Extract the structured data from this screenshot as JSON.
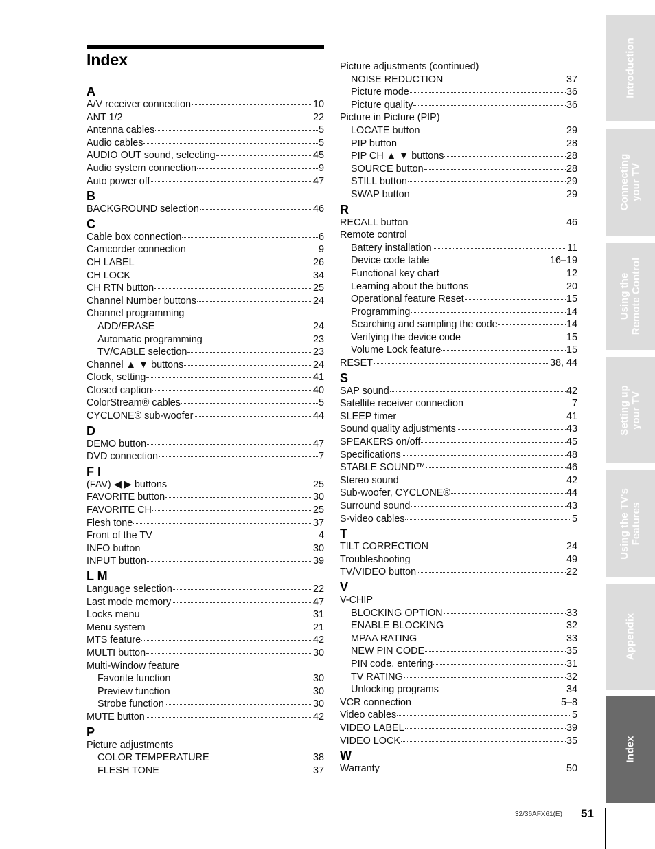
{
  "title": "Index",
  "left_column": [
    {
      "letter": "A",
      "entries": [
        {
          "label": "A/V receiver connection",
          "page": "10"
        },
        {
          "label": "ANT 1/2",
          "page": "22"
        },
        {
          "label": "Antenna cables",
          "page": "5"
        },
        {
          "label": "Audio cables",
          "page": "5"
        },
        {
          "label": "AUDIO OUT sound, selecting",
          "page": "45"
        },
        {
          "label": "Audio system connection",
          "page": "9"
        },
        {
          "label": "Auto power off",
          "page": "47"
        }
      ]
    },
    {
      "letter": "B",
      "entries": [
        {
          "label": "BACKGROUND selection",
          "page": "46"
        }
      ]
    },
    {
      "letter": "C",
      "entries": [
        {
          "label": "Cable box connection",
          "page": "6"
        },
        {
          "label": "Camcorder connection",
          "page": "9"
        },
        {
          "label": "CH LABEL",
          "page": "26"
        },
        {
          "label": "CH LOCK",
          "page": "34"
        },
        {
          "label": "CH RTN button",
          "page": "25"
        },
        {
          "label": "Channel Number buttons",
          "page": "24"
        },
        {
          "label": "Channel programming",
          "page": "",
          "head": true
        },
        {
          "label": "ADD/ERASE",
          "page": "24",
          "sub": true
        },
        {
          "label": "Automatic programming",
          "page": "23",
          "sub": true
        },
        {
          "label": "TV/CABLE selection",
          "page": "23",
          "sub": true
        },
        {
          "label": "Channel ▲ ▼ buttons",
          "page": "24"
        },
        {
          "label": "Clock, setting",
          "page": "41"
        },
        {
          "label": "Closed caption",
          "page": "40"
        },
        {
          "label": "ColorStream® cables",
          "page": "5"
        },
        {
          "label": "CYCLONE® sub-woofer",
          "page": "44"
        }
      ]
    },
    {
      "letter": "D",
      "entries": [
        {
          "label": "DEMO button",
          "page": "47"
        },
        {
          "label": "DVD connection",
          "page": "7"
        }
      ]
    },
    {
      "letter": "F I",
      "entries": [
        {
          "label": "(FAV) ◀ ▶ buttons",
          "page": "25"
        },
        {
          "label": "FAVORITE button",
          "page": "30"
        },
        {
          "label": "FAVORITE CH",
          "page": "25"
        },
        {
          "label": "Flesh tone",
          "page": "37"
        },
        {
          "label": "Front of the TV",
          "page": "4"
        },
        {
          "label": "INFO button",
          "page": "30"
        },
        {
          "label": "INPUT button",
          "page": "39"
        }
      ]
    },
    {
      "letter": "L M",
      "entries": [
        {
          "label": "Language selection",
          "page": "22"
        },
        {
          "label": "Last mode memory",
          "page": "47"
        },
        {
          "label": "Locks menu",
          "page": "31"
        },
        {
          "label": "Menu system",
          "page": "21"
        },
        {
          "label": "MTS feature",
          "page": "42"
        },
        {
          "label": "MULTI button",
          "page": "30"
        },
        {
          "label": "Multi-Window feature",
          "page": "",
          "head": true
        },
        {
          "label": "Favorite function",
          "page": "30",
          "sub": true
        },
        {
          "label": "Preview function",
          "page": "30",
          "sub": true
        },
        {
          "label": "Strobe function",
          "page": "30",
          "sub": true
        },
        {
          "label": "MUTE button",
          "page": "42"
        }
      ]
    },
    {
      "letter": "P",
      "entries": [
        {
          "label": "Picture adjustments",
          "page": "",
          "head": true
        },
        {
          "label": "COLOR TEMPERATURE",
          "page": "38",
          "sub": true
        },
        {
          "label": "FLESH TONE",
          "page": "37",
          "sub": true
        }
      ]
    }
  ],
  "right_column": [
    {
      "letter": "",
      "entries": [
        {
          "label": "Picture adjustments (continued)",
          "page": "",
          "head": true
        },
        {
          "label": "NOISE REDUCTION",
          "page": "37",
          "sub": true
        },
        {
          "label": "Picture mode",
          "page": "36",
          "sub": true
        },
        {
          "label": "Picture quality",
          "page": "36",
          "sub": true
        },
        {
          "label": "Picture in Picture (PIP)",
          "page": "",
          "head": true
        },
        {
          "label": "LOCATE button",
          "page": "29",
          "sub": true
        },
        {
          "label": "PIP button",
          "page": "28",
          "sub": true
        },
        {
          "label": "PIP CH ▲ ▼ buttons",
          "page": "28",
          "sub": true
        },
        {
          "label": "SOURCE button",
          "page": "28",
          "sub": true
        },
        {
          "label": "STILL button",
          "page": "29",
          "sub": true
        },
        {
          "label": "SWAP button",
          "page": "29",
          "sub": true
        }
      ]
    },
    {
      "letter": "R",
      "entries": [
        {
          "label": "RECALL button",
          "page": "46"
        },
        {
          "label": "Remote control",
          "page": "",
          "head": true
        },
        {
          "label": "Battery installation",
          "page": "11",
          "sub": true
        },
        {
          "label": "Device code table",
          "page": "16–19",
          "sub": true
        },
        {
          "label": "Functional key chart",
          "page": "12",
          "sub": true
        },
        {
          "label": "Learning about the buttons",
          "page": "20",
          "sub": true
        },
        {
          "label": "Operational feature Reset",
          "page": "15",
          "sub": true
        },
        {
          "label": "Programming",
          "page": "14",
          "sub": true
        },
        {
          "label": "Searching and sampling the code",
          "page": "14",
          "sub": true
        },
        {
          "label": "Verifying the device code",
          "page": "15",
          "sub": true
        },
        {
          "label": "Volume Lock feature",
          "page": "15",
          "sub": true
        },
        {
          "label": "RESET",
          "page": "38, 44"
        }
      ]
    },
    {
      "letter": "S",
      "entries": [
        {
          "label": "SAP sound",
          "page": "42"
        },
        {
          "label": "Satellite receiver connection",
          "page": "7"
        },
        {
          "label": "SLEEP timer",
          "page": "41"
        },
        {
          "label": "Sound quality adjustments",
          "page": "43"
        },
        {
          "label": "SPEAKERS on/off",
          "page": "45"
        },
        {
          "label": "Specifications",
          "page": "48"
        },
        {
          "label": "STABLE SOUND™",
          "page": "46"
        },
        {
          "label": "Stereo sound",
          "page": "42"
        },
        {
          "label": "Sub-woofer, CYCLONE®",
          "page": "44"
        },
        {
          "label": "Surround sound",
          "page": "43"
        },
        {
          "label": "S-video cables",
          "page": "5"
        }
      ]
    },
    {
      "letter": "T",
      "entries": [
        {
          "label": "TILT CORRECTION",
          "page": "24"
        },
        {
          "label": "Troubleshooting",
          "page": "49"
        },
        {
          "label": "TV/VIDEO button",
          "page": "22"
        }
      ]
    },
    {
      "letter": "V",
      "entries": [
        {
          "label": "V-CHIP",
          "page": "",
          "head": true
        },
        {
          "label": "BLOCKING OPTION",
          "page": "33",
          "sub": true
        },
        {
          "label": "ENABLE BLOCKING",
          "page": "32",
          "sub": true
        },
        {
          "label": "MPAA RATING",
          "page": "33",
          "sub": true
        },
        {
          "label": "NEW PIN CODE",
          "page": "35",
          "sub": true
        },
        {
          "label": "PIN code, entering",
          "page": "31",
          "sub": true
        },
        {
          "label": "TV RATING",
          "page": "32",
          "sub": true
        },
        {
          "label": "Unlocking programs",
          "page": "34",
          "sub": true
        },
        {
          "label": "VCR connection",
          "page": "5–8"
        },
        {
          "label": "Video cables",
          "page": "5"
        },
        {
          "label": "VIDEO LABEL",
          "page": "39"
        },
        {
          "label": "VIDEO LOCK",
          "page": "35"
        }
      ]
    },
    {
      "letter": "W",
      "entries": [
        {
          "label": "Warranty",
          "page": "50"
        }
      ]
    }
  ],
  "side_tabs": [
    {
      "label": "Introduction",
      "active": false
    },
    {
      "label": "Connecting\nyour TV",
      "active": false
    },
    {
      "label": "Using the\nRemote Control",
      "active": false
    },
    {
      "label": "Setting up\nyour TV",
      "active": false
    },
    {
      "label": "Using the TV's\nFeatures",
      "active": false
    },
    {
      "label": "Appendix",
      "active": false
    },
    {
      "label": "Index",
      "active": true
    }
  ],
  "footer": {
    "model": "32/36AFX61(E)",
    "page_number": "51"
  },
  "colors": {
    "tab_inactive": "#dcdcdc",
    "tab_active": "#6a6a6a",
    "tab_text": "#ffffff",
    "rule": "#000000"
  }
}
